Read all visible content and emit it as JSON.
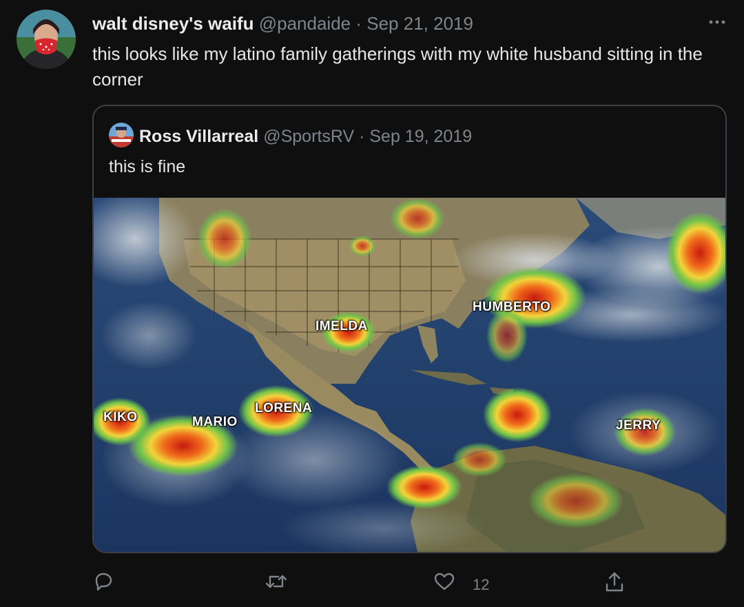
{
  "tweet": {
    "display_name": "walt disney's waifu",
    "handle": "@pandaide",
    "separator": "·",
    "date": "Sep 21, 2019",
    "text": "this looks like my latino family gatherings with my white husband sitting in the corner",
    "avatar_icon": "profile-photo-masked-person",
    "more_icon": "more-horizontal-icon"
  },
  "quoted": {
    "display_name": "Ross Villarreal",
    "handle": "@SportsRV",
    "separator": "·",
    "date": "Sep 19, 2019",
    "text": "this is fine",
    "media_icon": "weather-satellite-map-image",
    "storm_labels": {
      "kiko": "KIKO",
      "mario": "MARIO",
      "lorena": "LORENA",
      "imelda": "IMELDA",
      "humberto": "HUMBERTO",
      "jerry": "JERRY"
    }
  },
  "actions": {
    "reply_icon": "reply-icon",
    "retweet_icon": "retweet-icon",
    "like_icon": "heart-icon",
    "like_count": "12",
    "share_icon": "share-icon"
  },
  "colors": {
    "background": "#0f0f10",
    "text": "#e6e7e8",
    "secondary_text": "#7e858b",
    "card_border": "#3b4046"
  }
}
